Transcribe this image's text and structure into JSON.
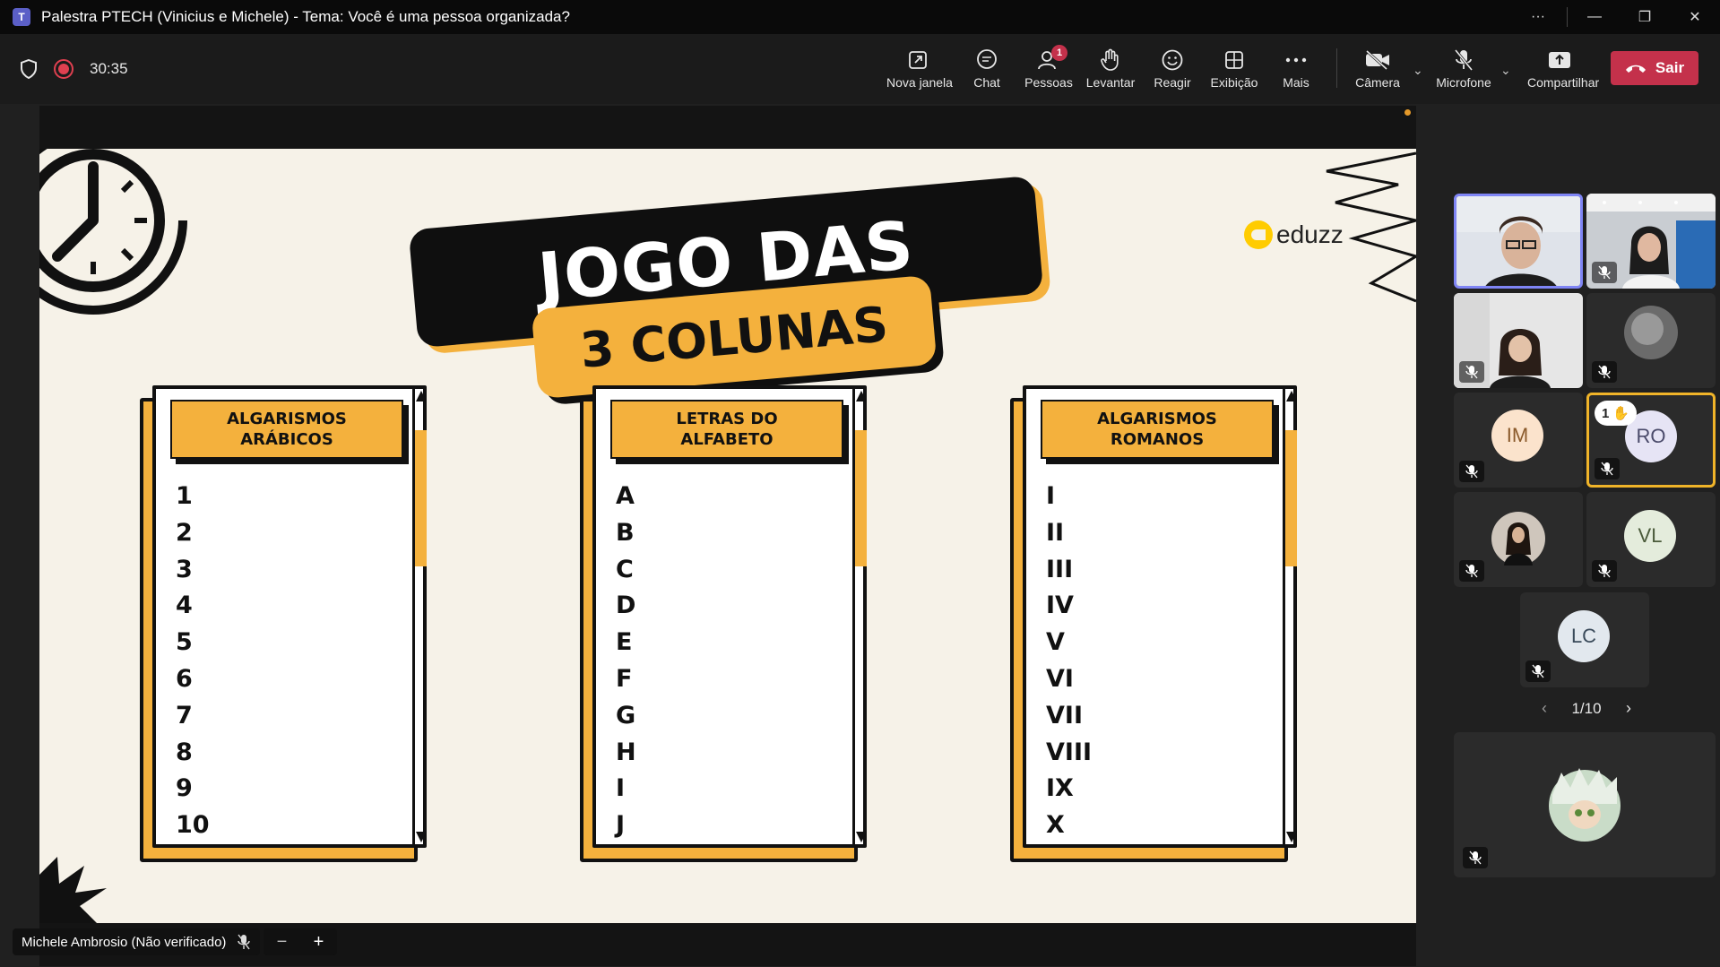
{
  "window": {
    "title": "Palestra PTECH (Vinicius e Michele) - Tema: Você é uma pessoa organizada?",
    "more": "···"
  },
  "meeting": {
    "timer": "30:35"
  },
  "toolbar": {
    "new_window": "Nova janela",
    "chat": "Chat",
    "people": "Pessoas",
    "people_badge": "1",
    "raise": "Levantar",
    "react": "Reagir",
    "view": "Exibição",
    "more": "Mais",
    "camera": "Câmera",
    "mic": "Microfone",
    "share": "Compartilhar",
    "leave": "Sair"
  },
  "slide": {
    "title_line1": "JOGO DAS",
    "title_line2": "3 COLUNAS",
    "logo": "eduzz",
    "columns": [
      {
        "header_line1": "ALGARISMOS",
        "header_line2": "ARÁBICOS",
        "items": [
          "1",
          "2",
          "3",
          "4",
          "5",
          "6",
          "7",
          "8",
          "9",
          "10"
        ]
      },
      {
        "header_line1": "LETRAS DO",
        "header_line2": "ALFABETO",
        "items": [
          "A",
          "B",
          "C",
          "D",
          "E",
          "F",
          "G",
          "H",
          "I",
          "J"
        ]
      },
      {
        "header_line1": "ALGARISMOS",
        "header_line2": "ROMANOS",
        "items": [
          "I",
          "II",
          "III",
          "IV",
          "V",
          "VI",
          "VII",
          "VIII",
          "IX",
          "X"
        ]
      }
    ]
  },
  "presenter": {
    "name": "Michele Ambrosio (Não verificado)",
    "zoom_out": "−",
    "zoom_in": "+"
  },
  "participants": {
    "initials": [
      "IM",
      "RO",
      "VL",
      "LC"
    ],
    "hand_count": "1",
    "pager": "1/10"
  },
  "colors": {
    "accent": "#f4b13d",
    "leave": "#c4314b",
    "active_border": "#7f85f5",
    "hand_border": "#f0b429"
  }
}
